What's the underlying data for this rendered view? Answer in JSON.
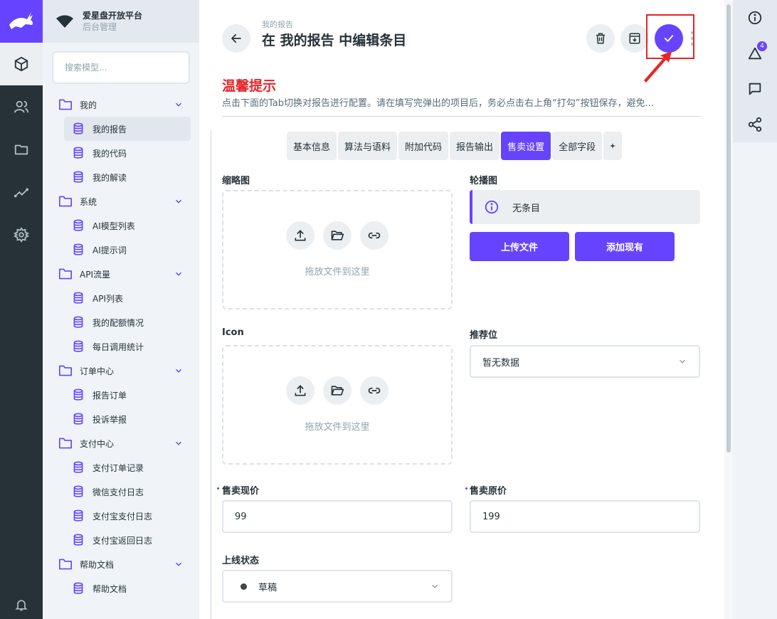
{
  "app": {
    "name": "爱星盘开放平台",
    "subtitle": "后台管理"
  },
  "colors": {
    "accent": "#6644ff",
    "warning_red": "#e5262a",
    "rail_dark": "#263238"
  },
  "rail": {
    "items": [
      {
        "icon": "cube-icon",
        "active": true
      },
      {
        "icon": "users-icon",
        "active": false
      },
      {
        "icon": "folder-icon",
        "active": false
      },
      {
        "icon": "trend-icon",
        "active": false
      },
      {
        "icon": "gear-icon",
        "active": false
      }
    ],
    "bottom_icon": "bell-icon"
  },
  "sidebar": {
    "search_placeholder": "搜索模型...",
    "groups": [
      {
        "label": "我的",
        "items": [
          "我的报告",
          "我的代码",
          "我的解读"
        ]
      },
      {
        "label": "系统",
        "items": [
          "AI模型列表",
          "AI提示词"
        ]
      },
      {
        "label": "API流量",
        "items": [
          "API列表",
          "我的配额情况",
          "每日调用统计"
        ]
      },
      {
        "label": "订单中心",
        "items": [
          "报告订单",
          "投诉举报"
        ]
      },
      {
        "label": "支付中心",
        "items": [
          "支付订单记录",
          "微信支付日志",
          "支付宝支付日志",
          "支付宝返回日志"
        ]
      },
      {
        "label": "帮助文档",
        "items": [
          "帮助文档"
        ]
      }
    ],
    "active_item": "我的报告"
  },
  "header": {
    "breadcrumb": "我的报告",
    "title": "在 我的报告 中编辑条目"
  },
  "tip": {
    "title": "温馨提示",
    "text": "点击下面的Tab切换对报告进行配置。请在填写完弹出的项目后，务必点击右上角“打勾”按钮保存，避免..."
  },
  "tabs": [
    "基本信息",
    "算法与语料",
    "附加代码",
    "报告输出",
    "售卖设置",
    "全部字段"
  ],
  "active_tab": "售卖设置",
  "form": {
    "thumbnail_label": "缩略图",
    "carousel_label": "轮播图",
    "dropzone_text": "拖放文件到这里",
    "carousel_empty": "无条目",
    "upload_button": "上传文件",
    "add_existing_button": "添加现有",
    "icon_label": "Icon",
    "recommend_label": "推荐位",
    "recommend_value": "暂无数据",
    "price_label": "售卖现价",
    "price_value": "99",
    "original_price_label": "售卖原价",
    "original_price_value": "199",
    "status_label": "上线状态",
    "status_value": "草稿"
  },
  "right_rail": {
    "notification_count": "4"
  }
}
